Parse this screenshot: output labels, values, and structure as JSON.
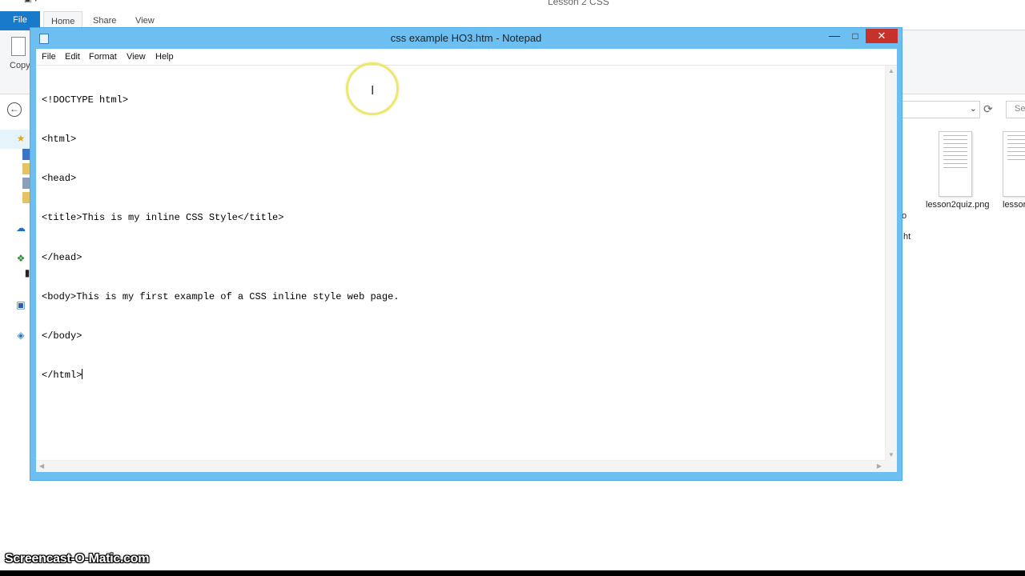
{
  "explorer": {
    "window_title": "Lesson 2 CSS",
    "ribbon_tabs": [
      "File",
      "Home",
      "Share",
      "View"
    ],
    "copy_label": "Copy",
    "search_placeholder": "Se",
    "files": [
      {
        "name": "lesson2quiz.png"
      },
      {
        "name": "lessor"
      }
    ],
    "cut_labels": [
      "o",
      "ht"
    ]
  },
  "notepad": {
    "title": "css example HO3.htm - Notepad",
    "menu": [
      "File",
      "Edit",
      "Format",
      "View",
      "Help"
    ],
    "lines": [
      "<!DOCTYPE html>",
      "<html>",
      "<head>",
      "<title>This is my inline CSS Style</title>",
      "</head>",
      "<body>This is my first example of a CSS inline style web page.",
      "</body>",
      "</html>"
    ],
    "controls": {
      "minimize": "—",
      "maximize": "□",
      "close": "✕"
    }
  },
  "watermark": "Screencast-O-Matic.com",
  "colors": {
    "notepad_frame": "#6dbff2",
    "close_button": "#c7312b",
    "file_tab": "#1979ca",
    "cursor_highlight": "#ece672"
  }
}
